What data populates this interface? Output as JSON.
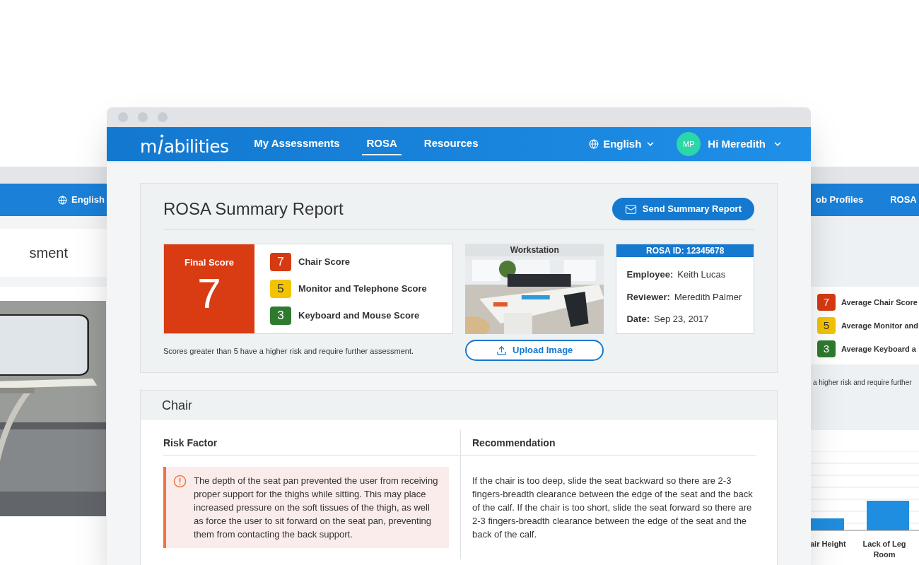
{
  "back_left_window": {
    "language": "English",
    "heading": "sment"
  },
  "back_right_window": {
    "nav_items": [
      {
        "label": "ob Profiles",
        "selected": false
      },
      {
        "label": "ROSA",
        "selected": false
      }
    ],
    "scores": [
      {
        "value": "7",
        "label": "Average Chair Score",
        "color": "#d63a12"
      },
      {
        "value": "5",
        "label": "Average Monitor and",
        "color": "#f3c300"
      },
      {
        "value": "3",
        "label": "Average Keyboard a",
        "color": "#2f7a2f"
      }
    ],
    "note": "a higher risk and require further",
    "bar_labels": [
      "air Height",
      "Lack of Leg Room"
    ]
  },
  "main_window": {
    "logo": {
      "before": "m",
      "after": "abilities"
    },
    "nav_items": [
      {
        "label": "My Assessments",
        "selected": false
      },
      {
        "label": "ROSA",
        "selected": true
      },
      {
        "label": "Resources",
        "selected": false
      }
    ],
    "language": "English",
    "user": {
      "initials": "MP",
      "greeting": "Hi Meredith"
    },
    "report": {
      "title": "ROSA Summary Report",
      "send_button": "Send Summary Report",
      "final_score": {
        "label": "Final Score",
        "value": "7",
        "color": "#d93b13"
      },
      "scores": [
        {
          "value": "7",
          "label": "Chair Score",
          "color": "#d63a12"
        },
        {
          "value": "5",
          "label": "Monitor and Telephone Score",
          "color": "#f3c300"
        },
        {
          "value": "3",
          "label": "Keyboard and Mouse Score",
          "color": "#2f7a2f"
        }
      ],
      "note": "Scores greater than 5 have a higher risk and require further assessment.",
      "workstation": {
        "title": "Workstation"
      },
      "upload_button": "Upload Image",
      "info": {
        "id": "ROSA ID: 12345678",
        "fields": [
          {
            "label": "Employee:",
            "value": "Keith Lucas"
          },
          {
            "label": "Reviewer:",
            "value": "Meredith Palmer"
          },
          {
            "label": "Date:",
            "value": "Sep 23, 2017"
          }
        ]
      }
    },
    "chair_section": {
      "title": "Chair",
      "columns": [
        "Risk Factor",
        "Recommendation"
      ],
      "rows": [
        {
          "risk": "The depth of the seat pan prevented the user from receiving proper support for the thighs while sitting. This may place increased pressure on the soft tissues of the thigh, as well as force the user to sit forward on the seat pan, preventing them from contacting the back support.",
          "recommendation": "If the chair is too deep, slide the seat backward so there are 2-3 fingers-breadth clearance between the edge of the seat and the back of the calf. If the chair is too short, slide the seat forward so there are 2-3 fingers-breadth clearance between the edge of the seat and the back of the calf."
        }
      ]
    }
  }
}
